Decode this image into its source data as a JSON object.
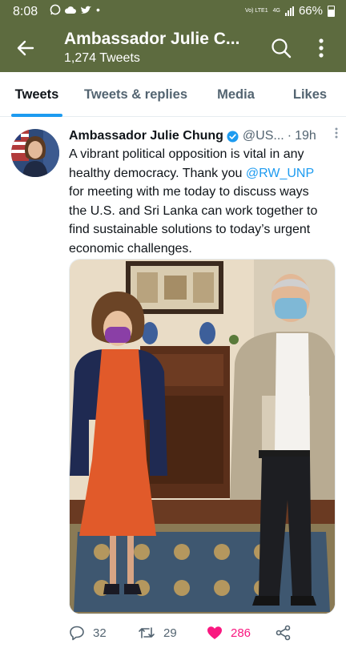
{
  "status_bar": {
    "time": "8:08",
    "network": "4G",
    "volte": "Vo) LTE1",
    "battery": "66%"
  },
  "header": {
    "title": "Ambassador Julie C...",
    "subtitle": "1,274 Tweets"
  },
  "tabs": [
    {
      "label": "Tweets",
      "active": true
    },
    {
      "label": "Tweets & replies",
      "active": false
    },
    {
      "label": "Media",
      "active": false
    },
    {
      "label": "Likes",
      "active": false
    }
  ],
  "tweet": {
    "author_name": "Ambassador Julie Chung",
    "handle": "@US...",
    "separator": "·",
    "time": "19h",
    "text_lines": [
      "A vibrant political opposition is vital in any",
      "healthy democracy. Thank you ",
      "@RW_UNP",
      "for meeting with me today to discuss ways",
      "the U.S. and Sri Lanka can work together to",
      "find sustainable solutions to today’s urgent",
      "economic challenges."
    ],
    "counts": {
      "replies": "32",
      "retweets": "29",
      "likes": "286"
    }
  },
  "colors": {
    "header_bg": "#5d6b3f",
    "accent": "#1d9bf0",
    "like": "#f91880",
    "secondary_text": "#536471"
  },
  "icons": [
    "back-arrow-icon",
    "search-icon",
    "more-vertical-icon",
    "verified-badge-icon",
    "reply-icon",
    "retweet-icon",
    "heart-icon",
    "share-icon"
  ]
}
